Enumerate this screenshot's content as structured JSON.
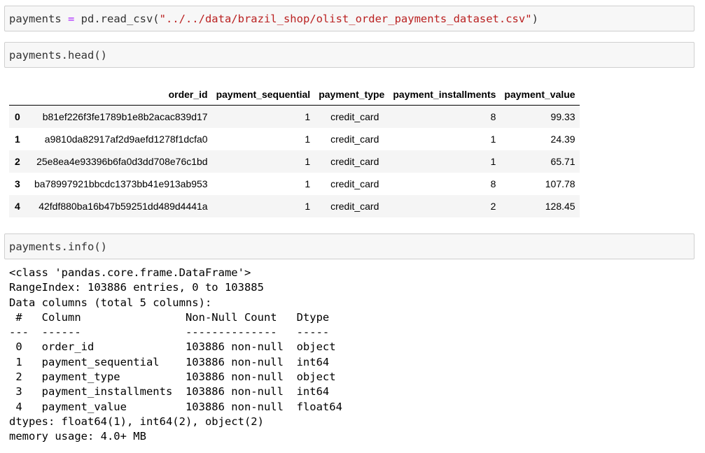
{
  "cells": {
    "read_csv": {
      "var": "payments",
      "op": " = ",
      "call": "pd.read_csv(",
      "path": "\"../../data/brazil_shop/olist_order_payments_dataset.csv\"",
      "close": ")"
    },
    "head": {
      "code": "payments.head()"
    },
    "info": {
      "code": "payments.info()"
    }
  },
  "head_table": {
    "columns": [
      "order_id",
      "payment_sequential",
      "payment_type",
      "payment_installments",
      "payment_value"
    ],
    "rows": [
      {
        "index": "0",
        "order_id": "b81ef226f3fe1789b1e8b2acac839d17",
        "payment_sequential": "1",
        "payment_type": "credit_card",
        "payment_installments": "8",
        "payment_value": "99.33"
      },
      {
        "index": "1",
        "order_id": "a9810da82917af2d9aefd1278f1dcfa0",
        "payment_sequential": "1",
        "payment_type": "credit_card",
        "payment_installments": "1",
        "payment_value": "24.39"
      },
      {
        "index": "2",
        "order_id": "25e8ea4e93396b6fa0d3dd708e76c1bd",
        "payment_sequential": "1",
        "payment_type": "credit_card",
        "payment_installments": "1",
        "payment_value": "65.71"
      },
      {
        "index": "3",
        "order_id": "ba78997921bbcdc1373bb41e913ab953",
        "payment_sequential": "1",
        "payment_type": "credit_card",
        "payment_installments": "8",
        "payment_value": "107.78"
      },
      {
        "index": "4",
        "order_id": "42fdf880ba16b47b59251dd489d4441a",
        "payment_sequential": "1",
        "payment_type": "credit_card",
        "payment_installments": "2",
        "payment_value": "128.45"
      }
    ]
  },
  "info_output": {
    "lines": [
      "<class 'pandas.core.frame.DataFrame'>",
      "RangeIndex: 103886 entries, 0 to 103885",
      "Data columns (total 5 columns):",
      " #   Column                Non-Null Count   Dtype  ",
      "---  ------                --------------   -----  ",
      " 0   order_id              103886 non-null  object ",
      " 1   payment_sequential    103886 non-null  int64  ",
      " 2   payment_type          103886 non-null  object ",
      " 3   payment_installments  103886 non-null  int64  ",
      " 4   payment_value         103886 non-null  float64",
      "dtypes: float64(1), int64(2), object(2)",
      "memory usage: 4.0+ MB"
    ]
  }
}
